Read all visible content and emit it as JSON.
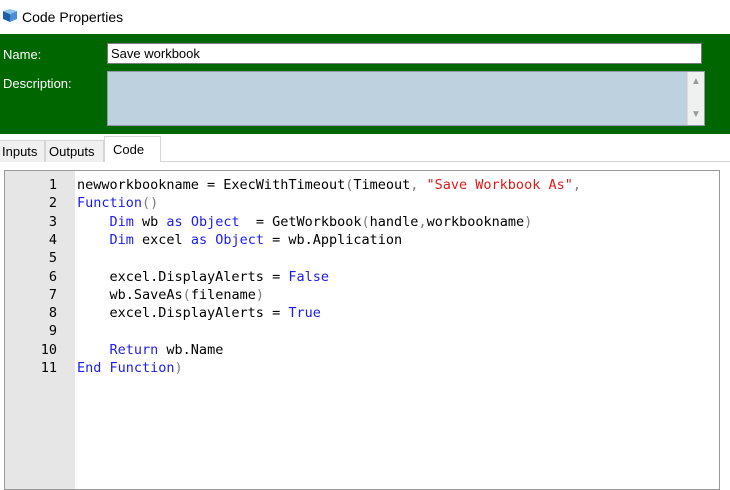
{
  "window": {
    "title": "Code Properties"
  },
  "form": {
    "name_label": "Name:",
    "name_value": "Save workbook",
    "description_label": "Description:",
    "description_value": ""
  },
  "tabs": [
    {
      "label": "Inputs"
    },
    {
      "label": "Outputs"
    },
    {
      "label": "Code",
      "active": true
    }
  ],
  "code": {
    "line_numbers": [
      "1",
      "2",
      "3",
      "4",
      "5",
      "6",
      "7",
      "8",
      "9",
      "10",
      "11"
    ],
    "lines": [
      [
        {
          "t": "newworkbookname = ExecWithTimeout",
          "c": ""
        },
        {
          "t": "(",
          "c": "pn"
        },
        {
          "t": "Timeout",
          "c": ""
        },
        {
          "t": ", ",
          "c": "pn"
        },
        {
          "t": "\"Save Workbook As\"",
          "c": "str"
        },
        {
          "t": ",",
          "c": "pn"
        }
      ],
      [
        {
          "t": "Function",
          "c": "kw"
        },
        {
          "t": "()",
          "c": "pn"
        }
      ],
      [
        {
          "t": "    ",
          "c": ""
        },
        {
          "t": "Dim",
          "c": "kw"
        },
        {
          "t": " wb ",
          "c": ""
        },
        {
          "t": "as",
          "c": "kw"
        },
        {
          "t": " ",
          "c": ""
        },
        {
          "t": "Object",
          "c": "kw"
        },
        {
          "t": "  = GetWorkbook",
          "c": ""
        },
        {
          "t": "(",
          "c": "pn"
        },
        {
          "t": "handle",
          "c": ""
        },
        {
          "t": ",",
          "c": "pn"
        },
        {
          "t": "workbookname",
          "c": ""
        },
        {
          "t": ")",
          "c": "pn"
        }
      ],
      [
        {
          "t": "    ",
          "c": ""
        },
        {
          "t": "Dim",
          "c": "kw"
        },
        {
          "t": " excel ",
          "c": ""
        },
        {
          "t": "as",
          "c": "kw"
        },
        {
          "t": " ",
          "c": ""
        },
        {
          "t": "Object",
          "c": "kw"
        },
        {
          "t": " = wb.Application",
          "c": ""
        }
      ],
      [],
      [
        {
          "t": "    excel.DisplayAlerts = ",
          "c": ""
        },
        {
          "t": "False",
          "c": "kw"
        }
      ],
      [
        {
          "t": "    wb.SaveAs",
          "c": ""
        },
        {
          "t": "(",
          "c": "pn"
        },
        {
          "t": "filename",
          "c": ""
        },
        {
          "t": ")",
          "c": "pn"
        }
      ],
      [
        {
          "t": "    excel.DisplayAlerts = ",
          "c": ""
        },
        {
          "t": "True",
          "c": "kw"
        }
      ],
      [],
      [
        {
          "t": "    ",
          "c": ""
        },
        {
          "t": "Return",
          "c": "kw"
        },
        {
          "t": " wb.Name",
          "c": ""
        }
      ],
      [
        {
          "t": "End Function",
          "c": "kw"
        },
        {
          "t": ")",
          "c": "pn"
        }
      ]
    ]
  },
  "colors": {
    "header_green": "#006600",
    "keyword_blue": "#1c1cf2",
    "string_red": "#e01a1a",
    "gutter_gray": "#e6e6e6",
    "description_bg": "#bdd1df"
  }
}
